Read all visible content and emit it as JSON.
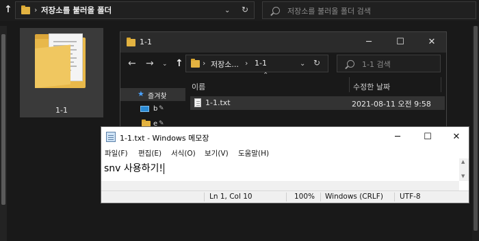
{
  "background": {
    "address_path": "저장소를 불러올 폴더",
    "search_placeholder": "저장소를 불러올 폴더 검색",
    "folder_label": "1-1"
  },
  "explorer": {
    "title": "1-1",
    "breadcrumb_parent": "저장소...",
    "breadcrumb_current": "1-1",
    "search_placeholder": "1-1 검색",
    "sidebar": [
      {
        "label": "즐겨찾",
        "icon": "star-icon"
      },
      {
        "label": "b",
        "icon": "desktop-icon"
      },
      {
        "label": "e",
        "icon": "folder-icon"
      }
    ],
    "columns": {
      "name": "이름",
      "modified": "수정한 날짜"
    },
    "files": [
      {
        "name": "1-1.txt",
        "modified": "2021-08-11 오전 9:58"
      }
    ]
  },
  "notepad": {
    "title": "1-1.txt - Windows 메모장",
    "menu": [
      "파일(F)",
      "편집(E)",
      "서식(O)",
      "보기(V)",
      "도움말(H)"
    ],
    "content": "snv 사용하기!",
    "status": {
      "position": "Ln 1, Col 10",
      "zoom": "100%",
      "line_ending": "Windows (CRLF)",
      "encoding": "UTF-8"
    }
  },
  "colors": {
    "dark_bg": "#191919",
    "folder_yellow": "#e3b341",
    "accent_blue": "#0078d7"
  }
}
